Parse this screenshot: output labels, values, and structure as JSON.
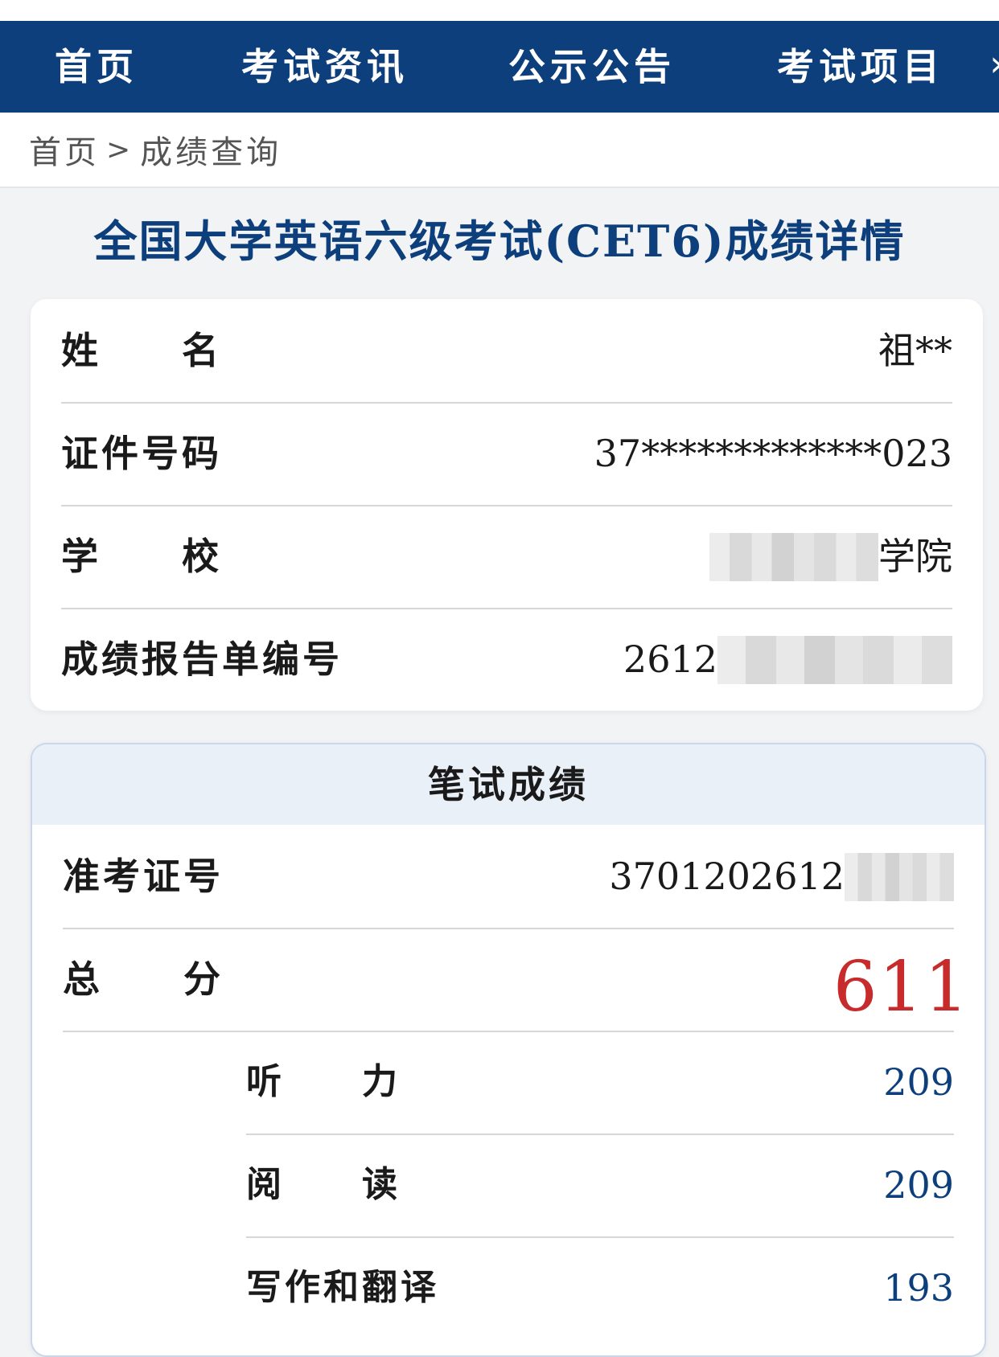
{
  "nav": {
    "items": [
      "首页",
      "考试资讯",
      "公示公告",
      "考试项目"
    ],
    "more": "›"
  },
  "breadcrumb": {
    "home": "首页",
    "separator": ">",
    "current": "成绩查询"
  },
  "page_title": "全国大学英语六级考试(CET6)成绩详情",
  "info": {
    "name_label": "姓　　名",
    "name_value": "祖**",
    "id_label": "证件号码",
    "id_value": "37*************023",
    "school_label": "学　　校",
    "school_value_suffix": "学院",
    "report_label": "成绩报告单编号",
    "report_value_prefix": "2612"
  },
  "score": {
    "section_title": "笔试成绩",
    "ticket_label": "准考证号",
    "ticket_value_prefix": "3701202612",
    "total_label": "总　　分",
    "total_value": "611",
    "listening_label": "听　　力",
    "listening_value": "209",
    "reading_label": "阅　　读",
    "reading_value": "209",
    "writing_label": "写作和翻译",
    "writing_value": "193"
  },
  "colors": {
    "nav_bg": "#0d3f7d",
    "title": "#0d3f7d",
    "total": "#c82b2b",
    "section_head_bg": "#eaf0f8"
  }
}
